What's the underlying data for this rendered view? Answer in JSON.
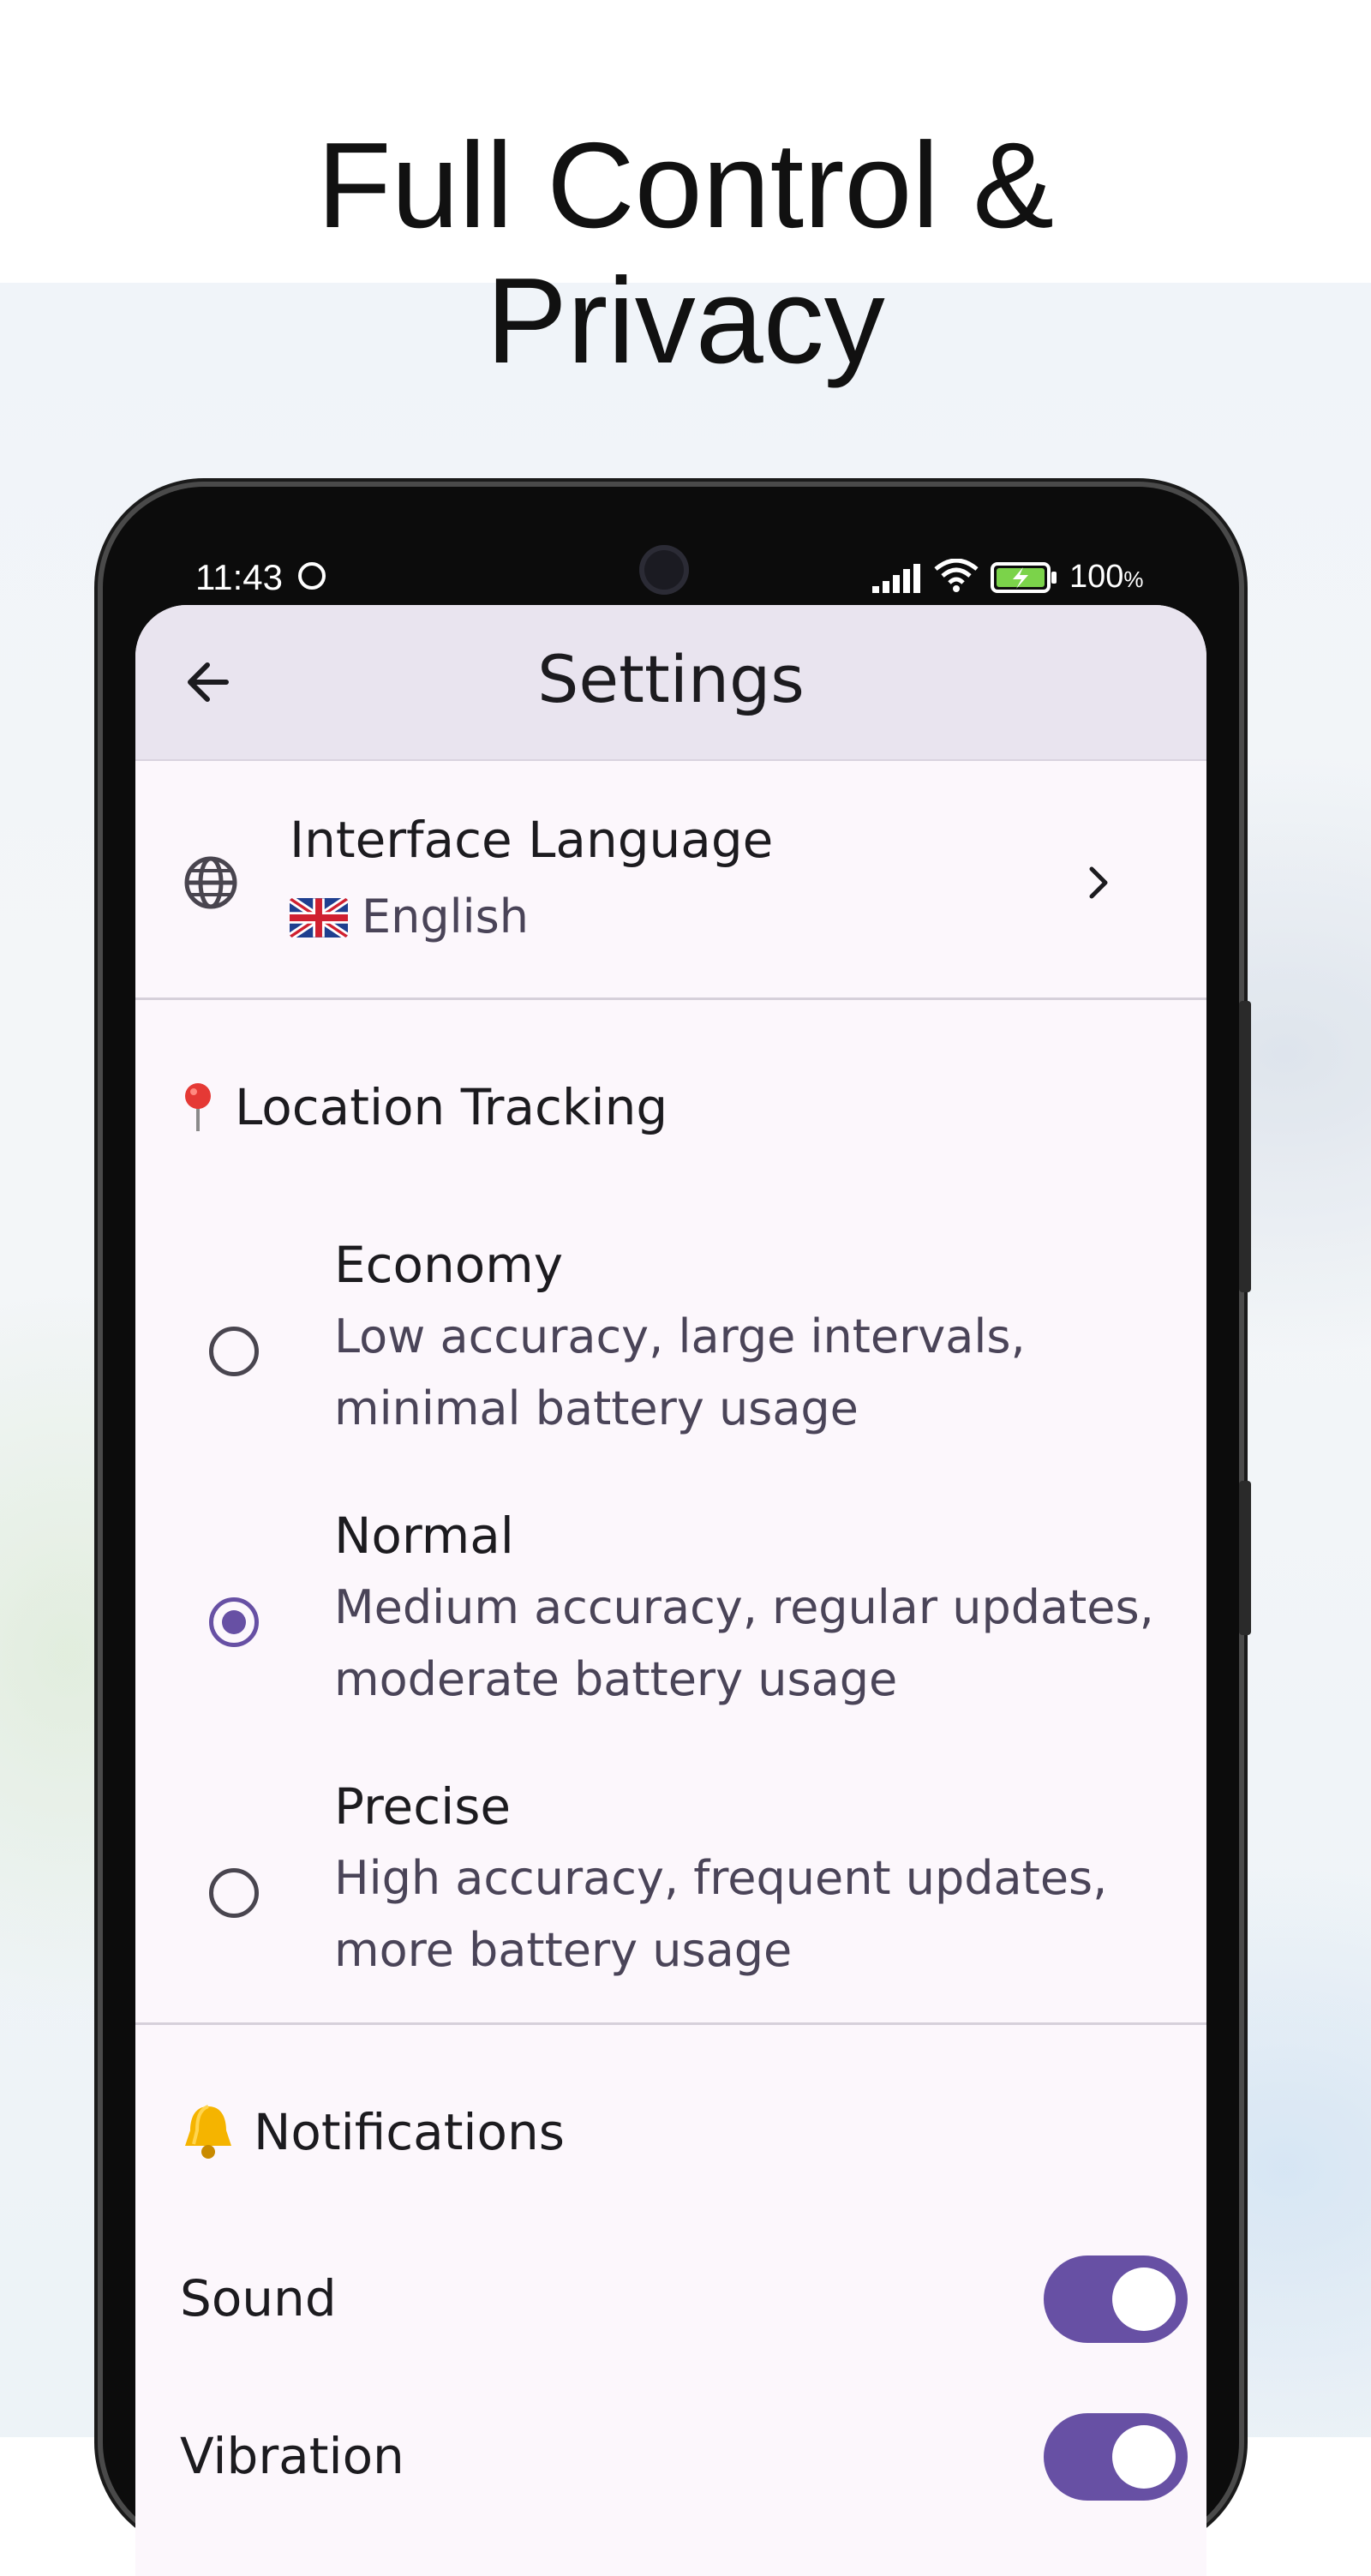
{
  "headline": {
    "line1": "Full Control &",
    "line2": "Privacy"
  },
  "status_bar": {
    "time": "11:43",
    "battery_level": "100",
    "battery_unit": "%"
  },
  "app_bar": {
    "title": "Settings",
    "back_icon": "arrow-back-icon"
  },
  "language": {
    "title": "Interface Language",
    "value": "English",
    "icon": "globe-icon",
    "flag": "uk-flag-icon"
  },
  "location": {
    "section_title": "Location Tracking",
    "icon": "pin-icon",
    "options": [
      {
        "title": "Economy",
        "description": "Low accuracy, large intervals, minimal battery usage",
        "selected": false
      },
      {
        "title": "Normal",
        "description": "Medium accuracy, regular updates, moderate battery usage",
        "selected": true
      },
      {
        "title": "Precise",
        "description": "High accuracy, frequent updates, more battery usage",
        "selected": false
      }
    ]
  },
  "notifications": {
    "section_title": "Notifications",
    "icon": "bell-icon",
    "items": [
      {
        "label": "Sound",
        "enabled": true
      },
      {
        "label": "Vibration",
        "enabled": true
      }
    ]
  },
  "colors": {
    "accent": "#6750a4",
    "surface": "#fcf7fc",
    "app_bar": "#e9e4ef"
  }
}
